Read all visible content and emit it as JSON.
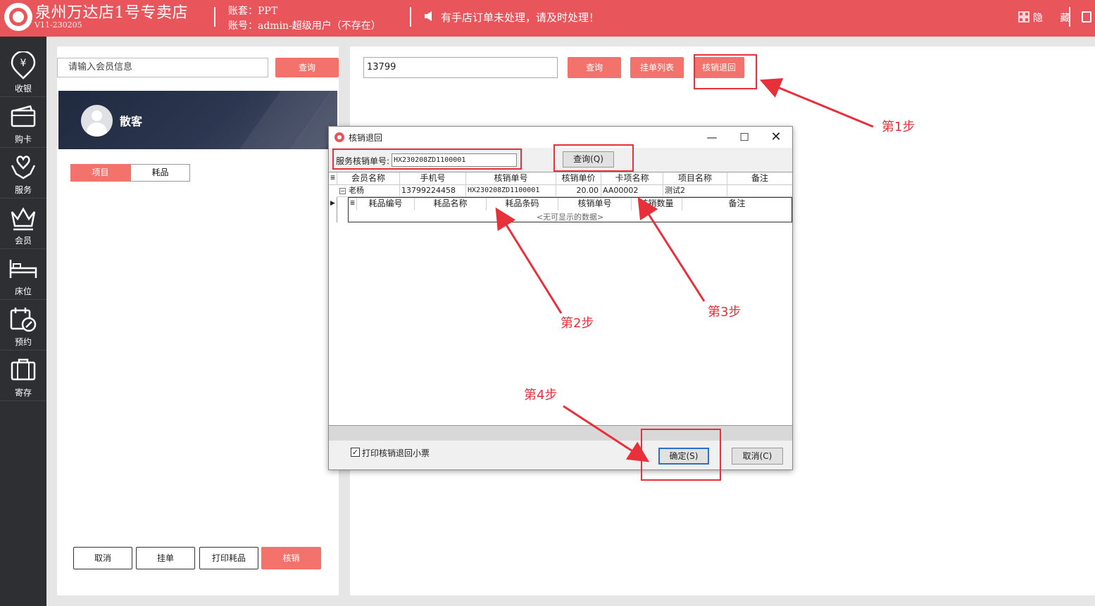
{
  "header": {
    "store_name": "泉州万达店1号专卖店",
    "version": "V11-230205",
    "account_set": "账套：PPT",
    "account_user": "账号：admin-超级用户（不存在）",
    "notice": "有手店订单未处理，请及时处理！",
    "hide_label": "隐 藏",
    "accent_color": "#e8565c"
  },
  "sidebar": {
    "items": [
      {
        "label": "收银",
        "icon": "cashier-icon"
      },
      {
        "label": "购卡",
        "icon": "card-icon"
      },
      {
        "label": "服务",
        "icon": "service-icon"
      },
      {
        "label": "会员",
        "icon": "crown-icon"
      },
      {
        "label": "床位",
        "icon": "bed-icon"
      },
      {
        "label": "预约",
        "icon": "calendar-icon"
      },
      {
        "label": "寄存",
        "icon": "storage-icon"
      }
    ]
  },
  "left": {
    "member_placeholder": "请输入会员信息",
    "search_label": "查询",
    "guest_name": "散客",
    "tabs": [
      "项目",
      "耗品"
    ],
    "buttons": {
      "cancel": "取消",
      "hang": "挂单",
      "print": "打印耗品",
      "writeoff": "核销"
    }
  },
  "right": {
    "order_value": "13799",
    "search_label": "查询",
    "hang_list_label": "挂单列表",
    "writeoff_return_label": "核销退回"
  },
  "dialog": {
    "title": "核销退回",
    "service_label": "服务核销单号:",
    "service_value": "HX230208ZD1100001",
    "query_label": "查询(Q)",
    "columns": [
      "会员名称",
      "手机号",
      "核销单号",
      "核销单价",
      "卡项名称",
      "项目名称",
      "备注"
    ],
    "row": {
      "member": "老杨",
      "phone": "13799224458",
      "order": "HX230208ZD1100001",
      "price": "20.00",
      "card": "AA00002",
      "item": "测试2",
      "note": ""
    },
    "sub_columns": [
      "耗品编号",
      "耗品名称",
      "耗品条码",
      "核销单号",
      "核销数量",
      "备注"
    ],
    "sub_empty": "<无可显示的数据>",
    "print_checked": true,
    "print_label": "打印核销退回小票",
    "ok_label": "确定(S)",
    "cancel_label": "取消(C)"
  },
  "annotations": {
    "step1": "第1步",
    "step2": "第2步",
    "step3": "第3步",
    "step4": "第4步",
    "color": "#e8303a"
  }
}
